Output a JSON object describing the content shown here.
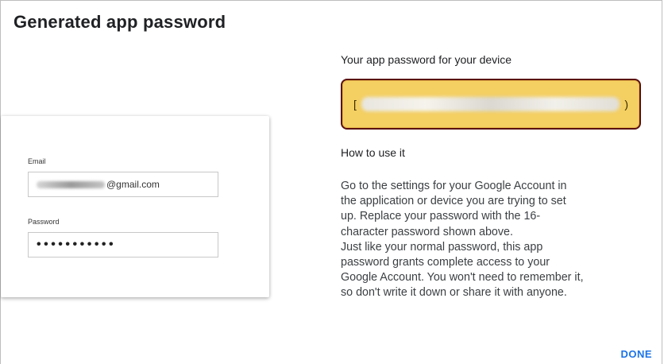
{
  "dialog": {
    "title": "Generated app password",
    "done_label": "DONE"
  },
  "sign_in_card": {
    "email_label": "Email",
    "email_suffix": "@gmail.com",
    "password_label": "Password",
    "password_mask": "•••••••••••"
  },
  "password_panel": {
    "subtitle": "Your app password for your device",
    "password_left_char": "[",
    "password_right_char": ")",
    "highlight_color": "#f4cf62",
    "border_color": "#5a1010"
  },
  "how_to": {
    "heading": "How to use it",
    "instructions": "Go to the settings for your Google Account in\nthe application or device you are trying to set\nup. Replace your password with the 16-\ncharacter password shown above.\nJust like your normal password, this app\npassword grants complete access to your\nGoogle Account. You won't need to remember it,\nso don't write it down or share it with anyone."
  },
  "colors": {
    "accent": "#1a73e8"
  }
}
